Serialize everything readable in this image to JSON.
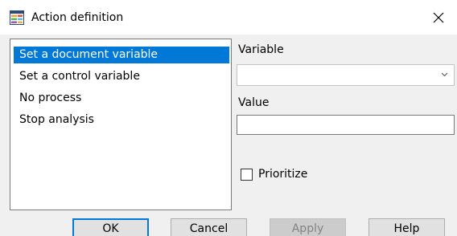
{
  "window": {
    "title": "Action definition"
  },
  "actions": {
    "items": [
      {
        "label": "Set a document variable"
      },
      {
        "label": "Set a control variable"
      },
      {
        "label": "No process"
      },
      {
        "label": "Stop analysis"
      }
    ],
    "selected": "Set a document variable"
  },
  "form": {
    "variable_label": "Variable",
    "variable_value": "",
    "value_label": "Value",
    "value_value": "",
    "prioritize_label": "Prioritize",
    "prioritize_checked": false
  },
  "buttons": {
    "ok": "OK",
    "cancel": "Cancel",
    "apply": "Apply",
    "help": "Help"
  },
  "colors": {
    "selection": "#0078d7",
    "dialog_background": "#f0f0f0",
    "title_bar": "#ffffff"
  }
}
